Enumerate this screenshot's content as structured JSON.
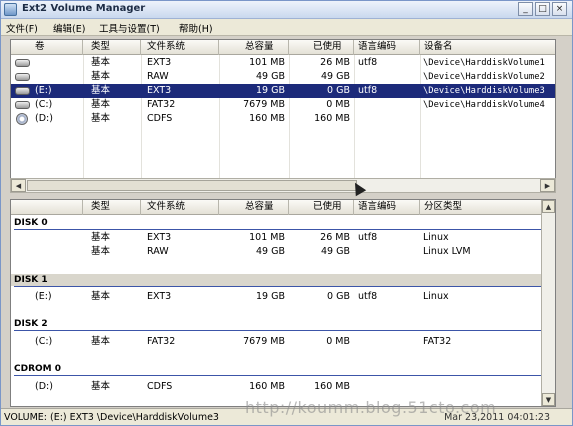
{
  "window": {
    "title": "Ext2 Volume Manager",
    "icon": "app-icon"
  },
  "controls": {
    "minimize": "_",
    "maximize": "□",
    "close": "×"
  },
  "menu": [
    "文件(F)",
    "编辑(E)",
    "工具与设置(T)",
    "帮助(H)"
  ],
  "upper": {
    "columns": [
      "卷",
      "类型",
      "文件系统",
      "总容量",
      "已使用",
      "语言编码",
      "设备名"
    ],
    "rows": [
      {
        "icon": "disk-icon",
        "vol": "",
        "type": "基本",
        "fs": "EXT3",
        "total": "101 MB",
        "used": "26 MB",
        "enc": "utf8",
        "dev": "\\Device\\HarddiskVolume1",
        "selected": false
      },
      {
        "icon": "disk-icon",
        "vol": "",
        "type": "基本",
        "fs": "RAW",
        "total": "49 GB",
        "used": "49 GB",
        "enc": "",
        "dev": "\\Device\\HarddiskVolume2",
        "selected": false
      },
      {
        "icon": "disk-icon",
        "vol": "(E:)",
        "type": "基本",
        "fs": "EXT3",
        "total": "19 GB",
        "used": "0 GB",
        "enc": "utf8",
        "dev": "\\Device\\HarddiskVolume3",
        "selected": true
      },
      {
        "icon": "disk-icon",
        "vol": "(C:)",
        "type": "基本",
        "fs": "FAT32",
        "total": "7679 MB",
        "used": "0 MB",
        "enc": "",
        "dev": "\\Device\\HarddiskVolume4",
        "selected": false
      },
      {
        "icon": "cdrom-icon",
        "vol": "(D:)",
        "type": "基本",
        "fs": "CDFS",
        "total": "160 MB",
        "used": "160 MB",
        "enc": "",
        "dev": "",
        "selected": false
      }
    ]
  },
  "lower": {
    "columns": [
      "类型",
      "文件系统",
      "总容量",
      "已使用",
      "语言编码",
      "分区类型"
    ],
    "groups": [
      {
        "name": "DISK 0",
        "shade": false,
        "rows": [
          {
            "vol": "",
            "type": "基本",
            "fs": "EXT3",
            "total": "101 MB",
            "used": "26 MB",
            "enc": "utf8",
            "ptype": "Linux"
          },
          {
            "vol": "",
            "type": "基本",
            "fs": "RAW",
            "total": "49 GB",
            "used": "49 GB",
            "enc": "",
            "ptype": "Linux LVM"
          }
        ]
      },
      {
        "name": "DISK 1",
        "shade": true,
        "rows": [
          {
            "vol": "(E:)",
            "type": "基本",
            "fs": "EXT3",
            "total": "19 GB",
            "used": "0 GB",
            "enc": "utf8",
            "ptype": "Linux"
          }
        ]
      },
      {
        "name": "DISK 2",
        "shade": false,
        "rows": [
          {
            "vol": "(C:)",
            "type": "基本",
            "fs": "FAT32",
            "total": "7679 MB",
            "used": "0 MB",
            "enc": "",
            "ptype": "FAT32"
          }
        ]
      },
      {
        "name": "CDROM 0",
        "shade": false,
        "rows": [
          {
            "vol": "(D:)",
            "type": "基本",
            "fs": "CDFS",
            "total": "160 MB",
            "used": "160 MB",
            "enc": "",
            "ptype": ""
          }
        ]
      }
    ]
  },
  "status": {
    "text": "VOLUME: (E:) EXT3 \\Device\\HarddiskVolume3",
    "time": "Mar 23,2011 04:01:23"
  },
  "watermark": "http://koumm.blog.51cto.com"
}
